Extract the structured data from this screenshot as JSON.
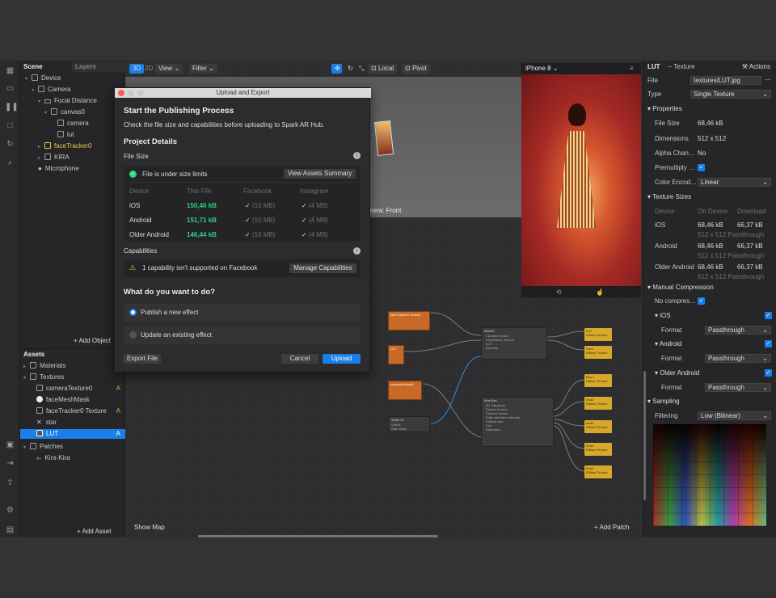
{
  "toolbar": {
    "mode3d": "3D",
    "mode2d": "2D",
    "view": "View",
    "filter": "Filter",
    "local": "Local",
    "pivot": "Pivot"
  },
  "scene": {
    "tab_scene": "Scene",
    "tab_layers": "Layers",
    "items": [
      "Device",
      "Camera",
      "Focal Distance",
      "canvas0",
      "camera",
      "lut",
      "faceTracker0",
      "KIRA",
      "Microphone"
    ],
    "add_object": "Add Object"
  },
  "assets": {
    "title": "Assets",
    "items": [
      "Materials",
      "Textures",
      "cameraTexture0",
      "faceMeshMask",
      "faceTracker0 Texture",
      "star",
      "LUT",
      "Patches",
      "Kira-Kira"
    ],
    "warn_mark": "A",
    "add_asset": "Add Asset"
  },
  "viewport": {
    "camera_label": "mera: Front",
    "show_map": "Show Map",
    "add_patch": "Add Patch"
  },
  "phone": {
    "device": "iPhone 8"
  },
  "patches": {
    "p1": "faceTracker0 Texture",
    "p2": "LUT",
    "p3": "cameraTexture0",
    "magic": "MAGIC",
    "magic_rows": [
      "Camera Texture",
      "Facetracker Texture",
      "LUT",
      "Intensity"
    ],
    "kira": "Kira-Kira",
    "kira_rows": [
      "2D Transform",
      "Particle texture",
      "Camera texture",
      "Edge detection intensity",
      "Particle size",
      "Hue",
      "Saturation"
    ],
    "slider": "Slider UI",
    "slider_rows": [
      "Visible",
      "Start Value"
    ],
    "outs": [
      [
        "LUT",
        "Diffuse Texture"
      ],
      [
        "Face",
        "Diffuse Texture"
      ],
      [
        "Kira 1",
        "Diffuse Texture"
      ],
      [
        "Kira2",
        "Diffuse Texture"
      ],
      [
        "Kira3",
        "Diffuse Texture"
      ],
      [
        "Kira4",
        "Diffuse Texture"
      ],
      [
        "Kira5",
        "Diffuse Texture"
      ]
    ]
  },
  "modal": {
    "window_title": "Upload and Export",
    "heading": "Start the Publishing Process",
    "subtitle": "Check the file size and capabilities before uploading to Spark AR Hub.",
    "project_details": "Project Details",
    "file_size": "File Size",
    "under_limit": "File is under size limits",
    "view_assets": "View Assets Summary",
    "cols": [
      "Device",
      "This File",
      "Facebook",
      "Instagram"
    ],
    "rows": [
      {
        "device": "iOS",
        "size": "150,46 kB",
        "fb": "(10 MB)",
        "ig": "(4 MB)"
      },
      {
        "device": "Android",
        "size": "151,71 kB",
        "fb": "(10 MB)",
        "ig": "(4 MB)"
      },
      {
        "device": "Older Android",
        "size": "146,44 kB",
        "fb": "(10 MB)",
        "ig": "(4 MB)"
      }
    ],
    "capabilities": "Capabilities",
    "cap_warning": "1 capability isn't supported on Facebook",
    "manage_caps": "Manage Capabilities",
    "question": "What do you want to do?",
    "opt_publish": "Publish a new effect",
    "opt_update": "Update an existing effect",
    "export": "Export File",
    "cancel": "Cancel",
    "upload": "Upload"
  },
  "props": {
    "name": "LUT",
    "kind": "– Texture",
    "actions": "Actions",
    "file_label": "File",
    "file_value": "textures/LUT.jpg",
    "type_label": "Type",
    "type_value": "Single Texture",
    "properties": "Properties",
    "file_size_label": "File Size",
    "file_size": "68,46 kB",
    "dim_label": "Dimensions",
    "dim": "512 x 512",
    "alpha_label": "Alpha Chan…",
    "alpha": "No",
    "premult_label": "Premultiply …",
    "color_label": "Color Encod…",
    "color": "Linear",
    "tex_sizes": "Texture Sizes",
    "ts_cols": [
      "Device",
      "On Device",
      "Download"
    ],
    "ts_rows": [
      {
        "d": "iOS",
        "on": "68,46 kB",
        "dl": "66,37 kB",
        "sub": "512 x 512 Passthrough"
      },
      {
        "d": "Android",
        "on": "68,46 kB",
        "dl": "66,37 kB",
        "sub": "512 x 512 Passthrough"
      },
      {
        "d": "Older Android",
        "on": "68,46 kB",
        "dl": "66,37 kB",
        "sub": "512 x 512 Passthrough"
      }
    ],
    "manual": "Manual Compression",
    "no_compress": "No compres…",
    "ios": "iOS",
    "android": "Android",
    "older": "Older Android",
    "format_label": "Format",
    "format": "Passthrough",
    "sampling": "Sampling",
    "filter_label": "Filtering",
    "filter": "Low (Bilinear)"
  },
  "colors": {
    "accent": "#1a7fe8",
    "green": "#2bd37d",
    "patch": "#c86a25",
    "out": "#d7a92a"
  }
}
